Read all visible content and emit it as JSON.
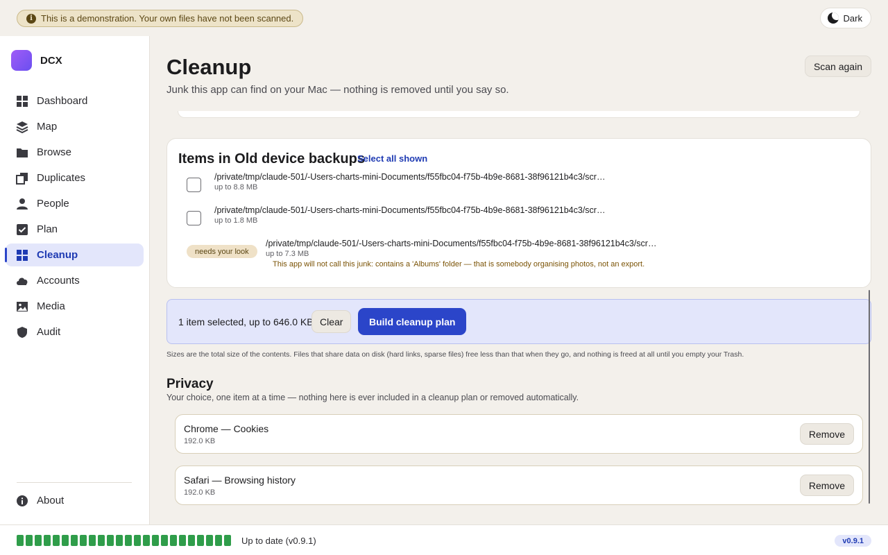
{
  "banner": {
    "text": "This is a demonstration. Your own files have not been scanned."
  },
  "theme_toggle": {
    "label": "Dark"
  },
  "brand": {
    "name": "DCX"
  },
  "sidebar": {
    "items": [
      {
        "label": "Dashboard",
        "icon": "dashboard-icon",
        "active": false
      },
      {
        "label": "Map",
        "icon": "layers-icon",
        "active": false
      },
      {
        "label": "Browse",
        "icon": "folder-icon",
        "active": false
      },
      {
        "label": "Duplicates",
        "icon": "copy-icon",
        "active": false
      },
      {
        "label": "People",
        "icon": "person-icon",
        "active": false
      },
      {
        "label": "Plan",
        "icon": "checkbox-icon",
        "active": false
      },
      {
        "label": "Cleanup",
        "icon": "grid-icon",
        "active": true
      },
      {
        "label": "Accounts",
        "icon": "cloud-icon",
        "active": false
      },
      {
        "label": "Media",
        "icon": "image-icon",
        "active": false
      },
      {
        "label": "Audit",
        "icon": "shield-icon",
        "active": false
      }
    ],
    "about_label": "About"
  },
  "main": {
    "title": "Cleanup",
    "subtitle": "Junk this app can find on your Mac — nothing is removed until you say so.",
    "scan_again_label": "Scan again"
  },
  "backups": {
    "title": "Items in Old device backups",
    "select_all_label": "Select all shown",
    "items": [
      {
        "path": "/private/tmp/claude-501/-Users-charts-mini-Documents/f55fbc04-f75b-4b9e-8681-38f96121b4c3/scr…",
        "size": "up to 8.8 MB"
      },
      {
        "path": "/private/tmp/claude-501/-Users-charts-mini-Documents/f55fbc04-f75b-4b9e-8681-38f96121b4c3/scr…",
        "size": "up to 1.8 MB"
      },
      {
        "badge": "needs your look",
        "path": "/private/tmp/claude-501/-Users-charts-mini-Documents/f55fbc04-f75b-4b9e-8681-38f96121b4c3/scr…",
        "size": "up to 7.3 MB",
        "note": "This app will not call this junk: contains a 'Albums' folder — that is somebody organising photos, not an export."
      }
    ]
  },
  "selection": {
    "text": "1 item selected, up to 646.0 KB",
    "clear_label": "Clear",
    "build_label": "Build cleanup plan"
  },
  "size_note": "Sizes are the total size of the contents. Files that share data on disk (hard links, sparse files) free less than that when they go, and nothing is freed at all until you empty your Trash.",
  "privacy": {
    "title": "Privacy",
    "description": "Your choice, one item at a time — nothing here is ever included in a cleanup plan or removed automatically.",
    "items": [
      {
        "name": "Chrome — Cookies",
        "size": "192.0 KB",
        "action": "Remove"
      },
      {
        "name": "Safari — Browsing history",
        "size": "192.0 KB",
        "action": "Remove"
      }
    ]
  },
  "footer": {
    "progress_fraction": 1.0,
    "status": "Up to date (v0.9.1)",
    "version": "v0.9.1"
  },
  "colors": {
    "accent": "#2b45c9",
    "progress": "#2f9d4a",
    "warning": "#7a5204"
  }
}
